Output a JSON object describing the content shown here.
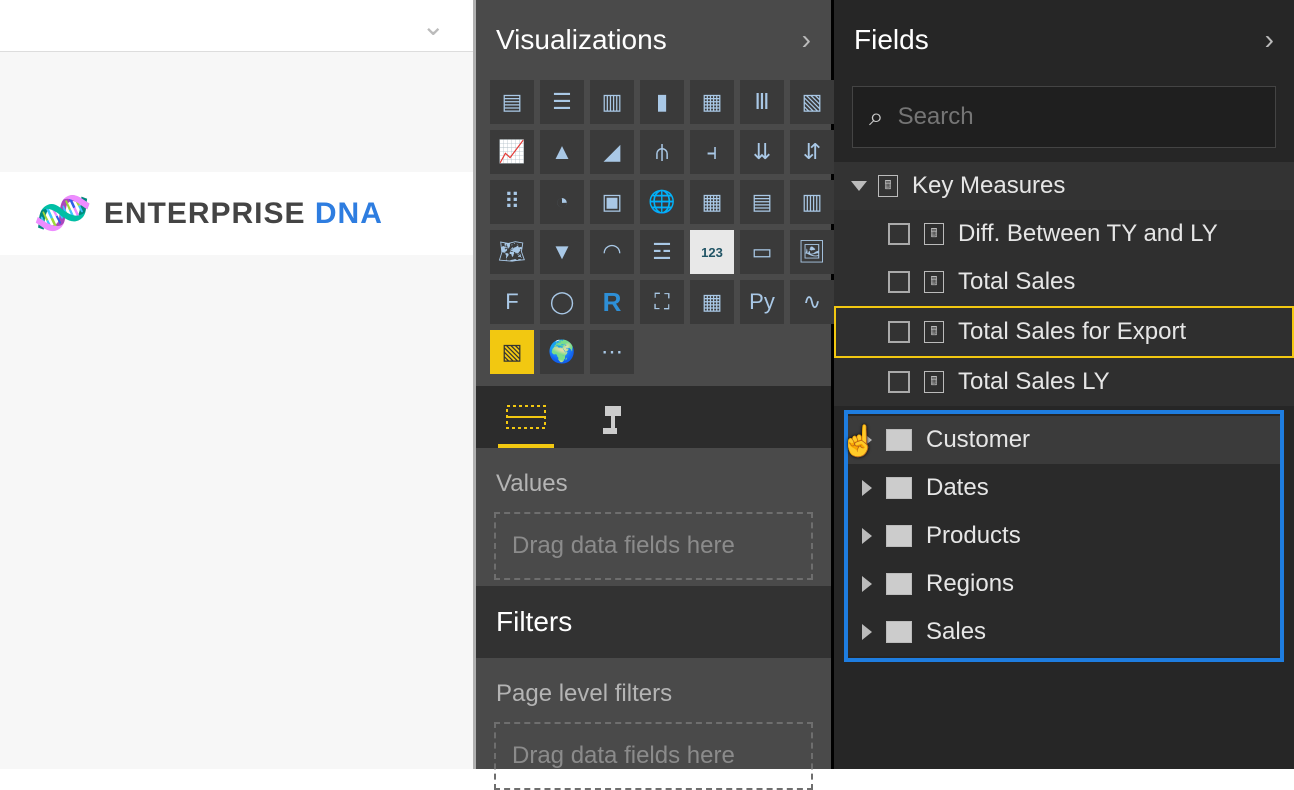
{
  "canvas": {
    "logo_primary": "ENTERPRISE ",
    "logo_secondary": "DNA"
  },
  "visualizations": {
    "header": "Visualizations",
    "tiles": [
      "stacked-bar",
      "clustered-bar",
      "stacked-column",
      "clustered-column",
      "100-bar",
      "100-column",
      "ribbon",
      "line",
      "area",
      "stacked-area",
      "line-bar",
      "line-col",
      "waterfall",
      "tornado",
      "scatter",
      "pie-donut",
      "treemap",
      "globe-map",
      "table",
      "matrix",
      "slicer",
      "filled-map",
      "funnel",
      "gauge",
      "multi-row",
      "kpi-123",
      "card",
      "image",
      "kpi-f",
      "donut",
      "r-visual",
      "arcgis",
      "table2",
      "py-visual",
      "sparkline",
      "x",
      "globe",
      "more"
    ],
    "values_label": "Values",
    "values_placeholder": "Drag data fields here",
    "filters_header": "Filters",
    "page_filters_label": "Page level filters",
    "page_filters_placeholder": "Drag data fields here"
  },
  "fields": {
    "header": "Fields",
    "search_placeholder": "Search",
    "measures_group": "Key Measures",
    "measures": [
      {
        "label": "Diff. Between TY and LY",
        "selected": false
      },
      {
        "label": "Total Sales",
        "selected": false
      },
      {
        "label": "Total Sales for Export",
        "selected": true
      },
      {
        "label": "Total Sales LY",
        "selected": false
      }
    ],
    "tables": [
      "Customer",
      "Dates",
      "Products",
      "Regions",
      "Sales"
    ]
  }
}
